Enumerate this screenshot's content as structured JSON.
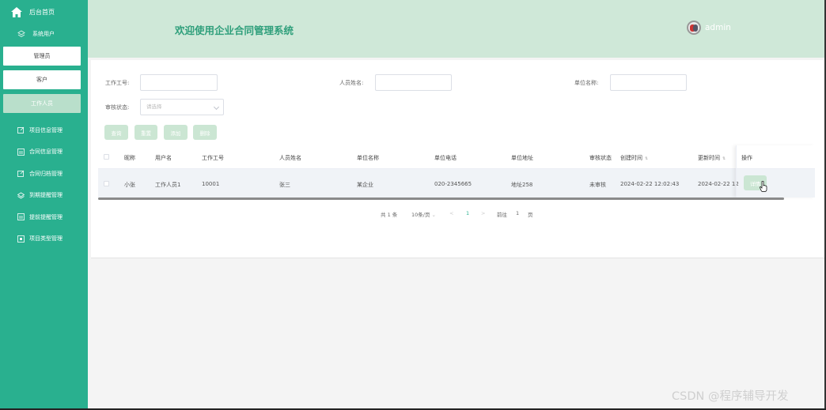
{
  "sidebar": {
    "home_label": "后台首页",
    "group_label": "系统用户",
    "sub_items": [
      "管理员",
      "客户",
      "工作人员"
    ],
    "active_sub": "工作人员",
    "items": [
      "项目信息管理",
      "合同信息管理",
      "合同归档管理",
      "到期提醒管理",
      "提前提醒管理",
      "项目类型管理"
    ]
  },
  "header": {
    "title": "欢迎使用企业合同管理系统",
    "username": "admin"
  },
  "search": {
    "label_worker_no": "工作工号:",
    "label_person_name": "人员姓名:",
    "label_unit_name": "单位名称:",
    "label_audit_status": "审核状态:",
    "audit_placeholder": "请选择",
    "buttons": {
      "query": "查询",
      "reset": "重置",
      "add": "添加",
      "delete": "删除"
    }
  },
  "table": {
    "headers": {
      "nickname": "昵称",
      "username": "用户名",
      "worker_no": "工作工号",
      "person_name": "人员姓名",
      "unit_name": "单位名称",
      "unit_phone": "单位电话",
      "unit_address": "单位地址",
      "audit_status": "审核状态",
      "create_time": "创建时间",
      "update_time": "更新时间",
      "action": "操作"
    },
    "rows": [
      {
        "nickname": "小张",
        "username": "工作人员1",
        "worker_no": "10001",
        "person_name": "张三",
        "unit_name": "某企业",
        "unit_phone": "020-2345665",
        "unit_address": "地址258",
        "audit_status": "未审核",
        "create_time": "2024-02-22 12:02:43",
        "update_time": "2024-02-22 12",
        "action_label": "详情"
      }
    ]
  },
  "pagination": {
    "total": "共 1 条",
    "page_size": "10条/页",
    "prev": "<",
    "current_page": "1",
    "next": ">",
    "goto_label": "前往",
    "goto_value": "1",
    "page_suffix": "页"
  },
  "watermark": "CSDN @程序辅导开发",
  "colors": {
    "sidebar_bg": "#29b08f",
    "header_bg": "#cfe8d8",
    "title_color": "#2f9f7b",
    "button_bg": "#cbe6d3"
  }
}
